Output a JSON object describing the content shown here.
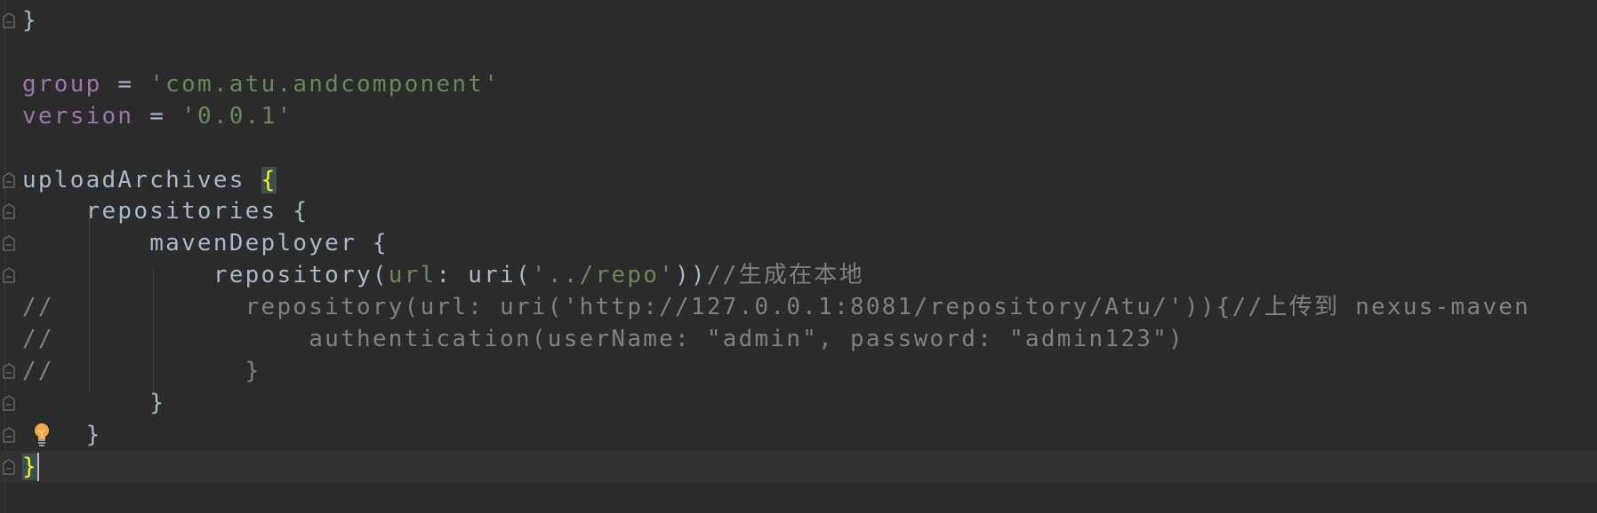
{
  "editor": {
    "colors": {
      "background": "#2b2b2b",
      "current_line": "#323232",
      "default_text": "#a9b7c6",
      "property": "#9876aa",
      "string": "#6a8759",
      "comment": "#808080",
      "matched_brace": "#ffef28"
    },
    "current_line_index": 14,
    "lightbulb_line_index": 13,
    "lines": [
      [
        {
          "t": "}",
          "k": "plain"
        }
      ],
      [],
      [
        {
          "t": "group",
          "k": "prop"
        },
        {
          "t": " = ",
          "k": "plain"
        },
        {
          "t": "'com.atu.andcomponent'",
          "k": "str"
        }
      ],
      [
        {
          "t": "version",
          "k": "prop"
        },
        {
          "t": " = ",
          "k": "plain"
        },
        {
          "t": "'0.0.1'",
          "k": "str"
        }
      ],
      [],
      [
        {
          "t": "uploadArchives ",
          "k": "plain"
        },
        {
          "t": "{",
          "k": "brace-match"
        }
      ],
      [
        {
          "t": "    repositories {",
          "k": "plain"
        }
      ],
      [
        {
          "t": "        mavenDeployer {",
          "k": "plain"
        }
      ],
      [
        {
          "t": "            repository(",
          "k": "plain"
        },
        {
          "t": "url",
          "k": "named"
        },
        {
          "t": ": uri(",
          "k": "plain"
        },
        {
          "t": "'../repo'",
          "k": "str"
        },
        {
          "t": "))",
          "k": "plain"
        },
        {
          "t": "//生成在本地",
          "k": "comment"
        }
      ],
      [
        {
          "t": "//            repository(url: uri('http://127.0.0.1:8081/repository/Atu/')){//上传到 nexus-maven",
          "k": "comment"
        }
      ],
      [
        {
          "t": "//                authentication(userName: \"admin\", password: \"admin123\")",
          "k": "comment"
        }
      ],
      [
        {
          "t": "//            }",
          "k": "comment"
        }
      ],
      [
        {
          "t": "        }",
          "k": "plain"
        }
      ],
      [
        {
          "t": "    }",
          "k": "plain"
        }
      ],
      [
        {
          "t": "}",
          "k": "brace-match"
        }
      ]
    ],
    "fold_marker_lines": [
      0,
      5,
      6,
      7,
      8,
      11,
      12,
      13,
      14
    ]
  }
}
